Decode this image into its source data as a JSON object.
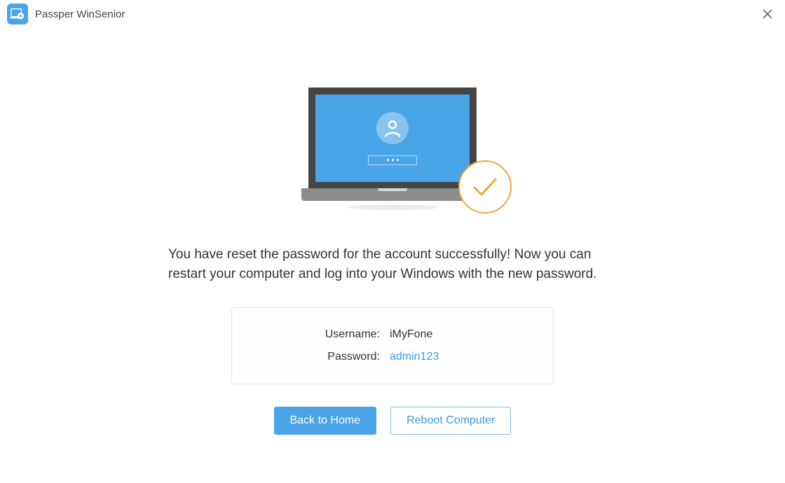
{
  "header": {
    "app_title": "Passper WinSenior"
  },
  "main": {
    "message": "You have reset the password for the account successfully! Now you can restart your computer and log into your Windows with the new password.",
    "credentials": {
      "username_label": "Username:",
      "username_value": "iMyFone",
      "password_label": "Password:",
      "password_value": "admin123"
    },
    "actions": {
      "back_home": "Back to Home",
      "reboot": "Reboot Computer"
    }
  }
}
